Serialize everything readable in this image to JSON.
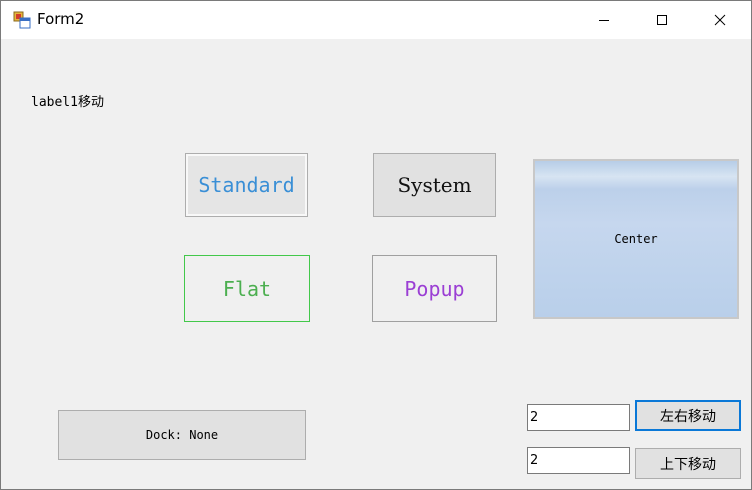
{
  "window": {
    "title": "Form2"
  },
  "label1": {
    "text": "label1移动"
  },
  "buttons": {
    "standard": "Standard",
    "system": "System",
    "flat": "Flat",
    "popup": "Popup",
    "center": "Center",
    "dock": "Dock: None",
    "move_lr": "左右移动",
    "move_ud": "上下移动"
  },
  "inputs": {
    "step_lr": "2",
    "step_ud": "2"
  },
  "colors": {
    "standard_text": "#3a8fd6",
    "flat_text": "#4caf50",
    "flat_border": "#42c84a",
    "popup_text": "#9b3fd4",
    "focus_border": "#0a78d7"
  }
}
